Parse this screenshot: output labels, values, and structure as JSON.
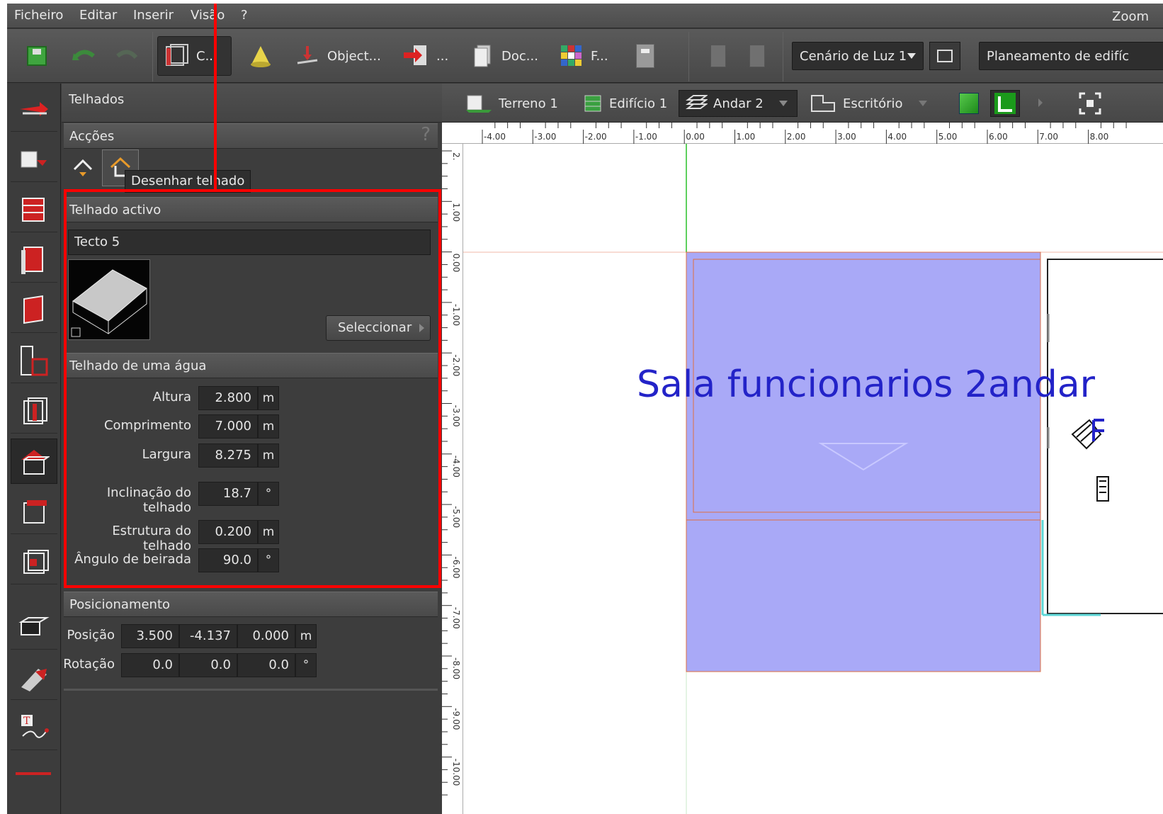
{
  "menu": {
    "items": [
      "Ficheiro",
      "Editar",
      "Inserir",
      "Visão",
      "?"
    ],
    "zoom": "Zoom"
  },
  "toolbar": {
    "construct": "C...",
    "objects": "Object...",
    "import_short": "...",
    "documents": "Doc...",
    "filters": "F...",
    "light_scenario": "Cenário de Luz 1",
    "planning": "Planeamento de edifíc"
  },
  "viewbar": {
    "terrain": "Terreno 1",
    "building": "Edifício 1",
    "floor": "Andar 2",
    "room": "Escritório"
  },
  "panel": {
    "title": "Telhados",
    "actions_head": "Acções",
    "help": "?",
    "tooltip": "Desenhar telhado",
    "active_head": "Telhado activo",
    "roof_name": "Tecto 5",
    "select_button": "Seleccionar",
    "shed_head": "Telhado de uma água",
    "fields": [
      {
        "label": "Altura",
        "value": "2.800",
        "unit": "m"
      },
      {
        "label": "Comprimento",
        "value": "7.000",
        "unit": "m"
      },
      {
        "label": "Largura",
        "value": "8.275",
        "unit": "m"
      },
      {
        "label": "Inclinação do telhado",
        "value": "18.7",
        "unit": "°"
      },
      {
        "label": "Estrutura do telhado",
        "value": "0.200",
        "unit": "m"
      },
      {
        "label": "Ângulo de beirada",
        "value": "90.0",
        "unit": "°"
      }
    ],
    "positioning_head": "Posicionamento",
    "position": {
      "label": "Posição",
      "x": "3.500",
      "y": "-4.137",
      "z": "0.000",
      "unit": "m"
    },
    "rotation": {
      "label": "Rotação",
      "x": "0.0",
      "y": "0.0",
      "z": "0.0",
      "unit": "°"
    }
  },
  "viewport": {
    "room_label": "Sala funcionarios 2andar",
    "ruler_h": [
      "-4.00",
      "-3.00",
      "-2.00",
      "-1.00",
      "0.00",
      "1.00",
      "2.00",
      "3.00",
      "4.00",
      "5.00",
      "6.00",
      "7.00",
      "8.00"
    ],
    "ruler_v": [
      "2.",
      "1.00",
      "0.00",
      "-1.00",
      "-2.00",
      "-3.00",
      "-4.00",
      "-5.00",
      "-6.00",
      "-7.00",
      "-8.00",
      "-9.00",
      "-10.00"
    ]
  },
  "colors": {
    "roof_fill": "#a9a9f7",
    "roof_border": "#e07040",
    "highlight": "#ff0000",
    "room_label": "#2323c8"
  }
}
